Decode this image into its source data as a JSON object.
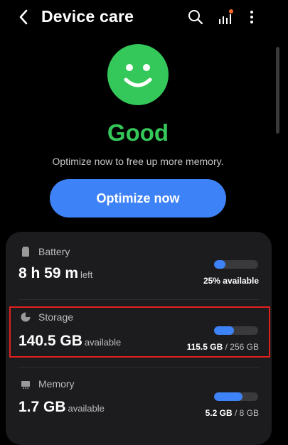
{
  "header": {
    "title": "Device care",
    "icons": {
      "back": "chevron-left-icon",
      "search": "search-icon",
      "stats": "bar-chart-icon",
      "more": "more-vertical-icon"
    }
  },
  "status": {
    "label": "Good",
    "message": "Optimize now to free up more memory.",
    "button_label": "Optimize now",
    "colors": {
      "status": "#34c759",
      "accent": "#3e82f7",
      "highlight": "#e0201f"
    }
  },
  "battery": {
    "label": "Battery",
    "time_value": "8 h 59 m",
    "time_suffix": "left",
    "available_text": "25% available",
    "fill_fraction": 0.25
  },
  "storage": {
    "label": "Storage",
    "value": "140.5 GB",
    "suffix": "available",
    "used": "115.5 GB",
    "separator": "/",
    "total": "256 GB",
    "fill_fraction": 0.45
  },
  "memory": {
    "label": "Memory",
    "value": "1.7 GB",
    "suffix": "available",
    "used": "5.2 GB",
    "separator": "/",
    "total": "8 GB",
    "fill_fraction": 0.65
  }
}
